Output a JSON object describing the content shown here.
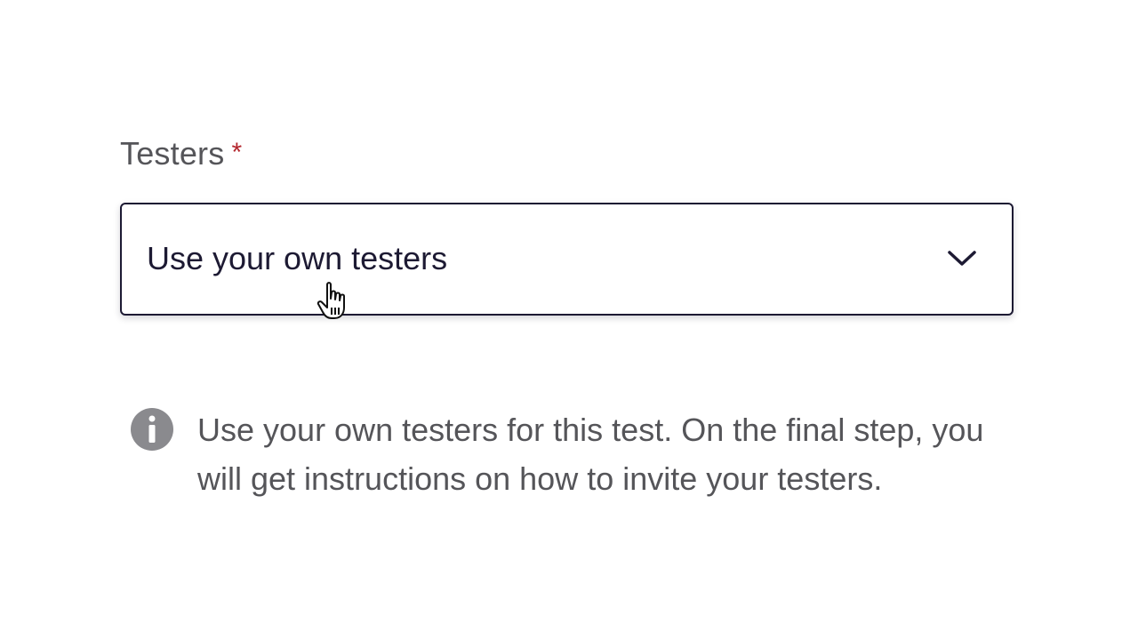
{
  "field": {
    "label": "Testers",
    "required_mark": "*",
    "selected_value": "Use your own testers",
    "dropdown_icon": "chevron-down-icon"
  },
  "info": {
    "icon": "info-icon",
    "text": "Use your own testers for this test. On the final step, you will get instructions on how to invite your testers."
  },
  "colors": {
    "label_text": "#555559",
    "required": "#b3262d",
    "select_border": "#1d1a33",
    "info_icon": "#8a8a8e"
  },
  "cursor": "hand-pointer-icon"
}
